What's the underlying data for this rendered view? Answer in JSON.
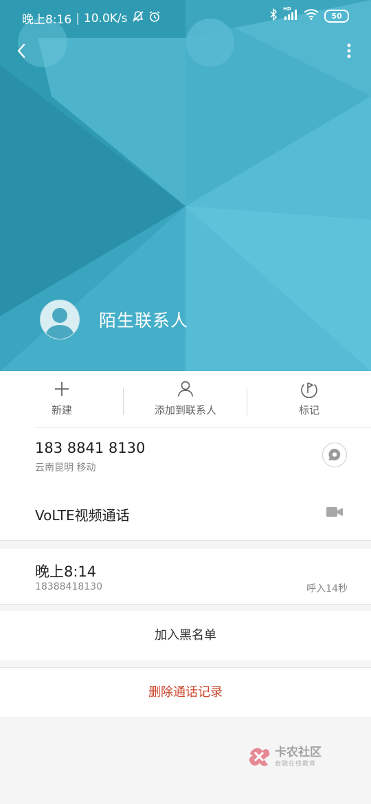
{
  "status_bar": {
    "time": "晚上8:16",
    "speed": "10.0K/s",
    "battery": "50",
    "network_label": "HD"
  },
  "contact": {
    "name": "陌生联系人"
  },
  "actions": [
    {
      "label": "新建",
      "icon": "plus-icon"
    },
    {
      "label": "添加到联系人",
      "icon": "person-icon"
    },
    {
      "label": "标记",
      "icon": "flag-icon"
    }
  ],
  "phone": {
    "number": "183 8841 8130",
    "location": "云南昆明 移动",
    "volte_label": "VoLTE视频通话"
  },
  "call_log": {
    "time": "晚上8:14",
    "number": "18388418130",
    "type": "呼入14秒"
  },
  "buttons": {
    "block": "加入黑名单",
    "delete": "删除通话记录"
  },
  "watermark": {
    "title": "卡农社区",
    "subtitle": "金融在线教育"
  },
  "colors": {
    "header_dark": "#2f9cb4",
    "header_light": "#55bdd6",
    "delete_red": "#c9452a"
  }
}
